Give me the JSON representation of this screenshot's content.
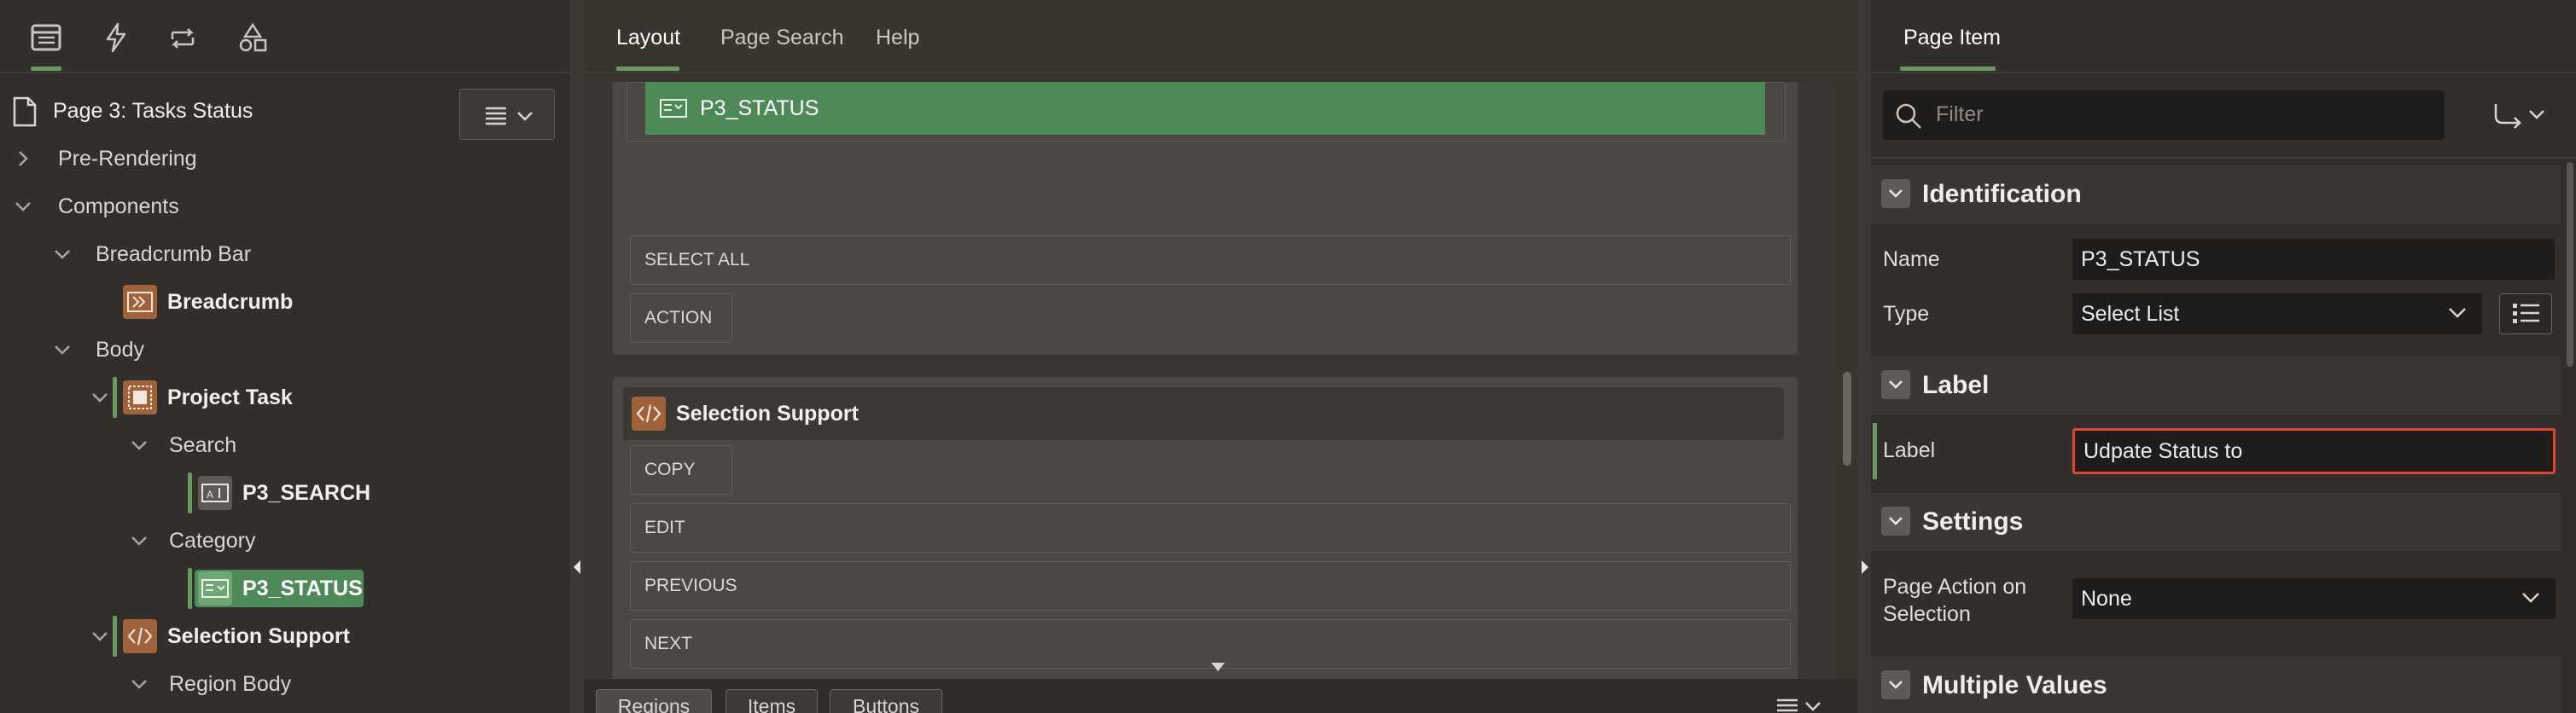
{
  "left_panel": {
    "toolbar_icons": [
      "rendering-tree-icon",
      "dynamic-actions-icon",
      "processing-icon",
      "shared-components-icon"
    ],
    "page_title": "Page 3: Tasks Status",
    "tree": [
      {
        "label": "Pre-Rendering"
      },
      {
        "label": "Components"
      },
      {
        "label": "Breadcrumb Bar"
      },
      {
        "label": "Breadcrumb"
      },
      {
        "label": "Body"
      },
      {
        "label": "Project Task"
      },
      {
        "label": "Search"
      },
      {
        "label": "P3_SEARCH"
      },
      {
        "label": "Category"
      },
      {
        "label": "P3_STATUS"
      },
      {
        "label": "Selection Support"
      },
      {
        "label": "Region Body"
      }
    ]
  },
  "middle": {
    "tabs": [
      "Layout",
      "Page Search",
      "Help"
    ],
    "active_tab": "Layout",
    "item_bar_label": "P3_STATUS",
    "slots_top": [
      "SELECT ALL",
      "ACTION"
    ],
    "region_title": "Selection Support",
    "slots_bottom": [
      "COPY",
      "EDIT",
      "PREVIOUS",
      "NEXT"
    ],
    "gallery_tabs": [
      "Regions",
      "Items",
      "Buttons"
    ]
  },
  "right": {
    "tab": "Page Item",
    "filter_placeholder": "Filter",
    "sections": {
      "identification": "Identification",
      "label": "Label",
      "settings": "Settings",
      "multiple_values": "Multiple Values"
    },
    "fields": {
      "name_label": "Name",
      "name_value": "P3_STATUS",
      "type_label": "Type",
      "type_value": "Select List",
      "label_label": "Label",
      "label_value": "Udpate Status to",
      "page_action_label_1": "Page Action on",
      "page_action_label_2": "Selection",
      "page_action_value": "None"
    }
  },
  "colors": {
    "accent_green": "#6a9a62",
    "selected_item": "#4e8a58",
    "highlight_border": "#e0442f",
    "region_icon": "#a0623a"
  }
}
